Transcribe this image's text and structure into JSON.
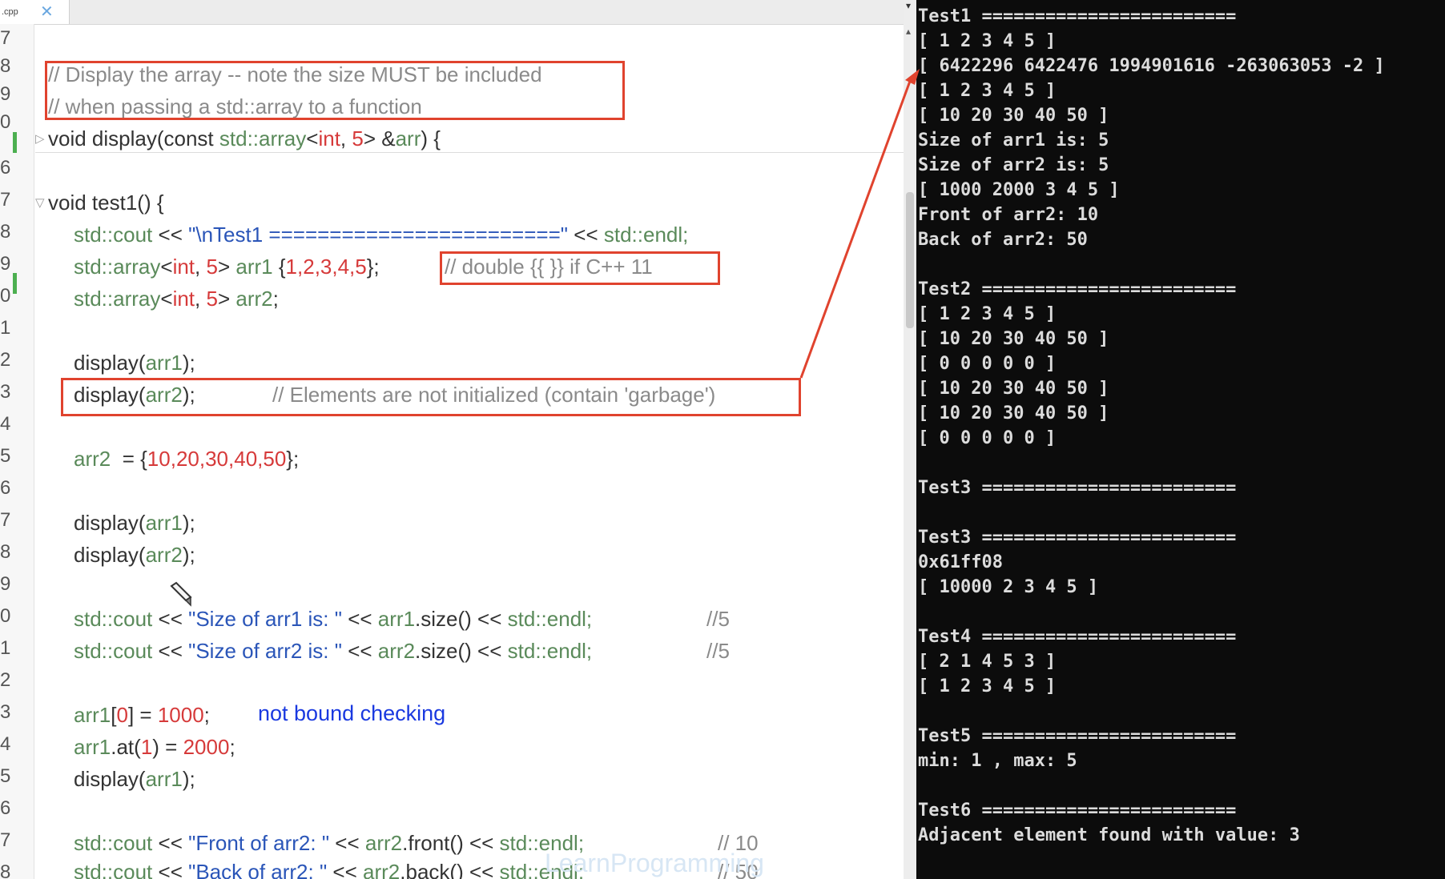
{
  "tab": {
    "filename": ".cpp",
    "close": "✕"
  },
  "line_numbers": [
    "7",
    "8",
    "9",
    "0",
    "6",
    "7",
    "8",
    "9",
    "0",
    "1",
    "2",
    "3",
    "4",
    "5",
    "6",
    "7",
    "8",
    "9",
    "0",
    "1",
    "2",
    "3",
    "4",
    "5",
    "6",
    "7",
    "8"
  ],
  "code": {
    "comment1": "// Display the array -- note the size MUST be included",
    "comment2": "// when passing a std::array to a function",
    "display_sig": [
      "void display(const ",
      "std::array",
      "<",
      "int",
      ", ",
      "5",
      "> &",
      "arr",
      ") {"
    ],
    "test1_sig": "void test1() {",
    "cout_test1": [
      "std::cout",
      " << ",
      "\"\\nTest1 ========================\"",
      " << ",
      "std::endl;"
    ],
    "arr1_decl": [
      "std::array",
      "<",
      "int",
      ", ",
      "5",
      "> ",
      "arr1",
      " {",
      "1,2,3,4,5",
      "};"
    ],
    "arr1_comment": "// double {{ }} if C++ 11",
    "arr2_decl": [
      "std::array",
      "<",
      "int",
      ", ",
      "5",
      "> ",
      "arr2",
      ";"
    ],
    "display_arr1": [
      "display(",
      "arr1",
      ");"
    ],
    "display_arr2": [
      "display(",
      "arr2",
      ");"
    ],
    "display_arr2_comment": "// Elements are not initialized (contain 'garbage')",
    "arr2_assign": [
      "arr2",
      "  = {",
      "10,20,30,40,50",
      "};"
    ],
    "size_arr1": [
      "std::cout",
      " << ",
      "\"Size of arr1 is: \"",
      " << ",
      "arr1",
      ".size() << ",
      "std::endl;",
      "//5"
    ],
    "size_arr2": [
      "std::cout",
      " << ",
      "\"Size of arr2 is: \"",
      " << ",
      "arr2",
      ".size() << ",
      "std::endl;",
      "//5"
    ],
    "arr1_index": [
      "arr1",
      "[",
      "0",
      "] = ",
      "1000",
      ";"
    ],
    "bound_note": "not bound checking",
    "arr1_at": [
      "arr1",
      ".at(",
      "1",
      ") = ",
      "2000",
      ";"
    ],
    "front_line": [
      "std::cout",
      " << ",
      "\"Front of arr2: \"",
      " << ",
      "arr2",
      ".front() << ",
      "std::endl;",
      "// 10"
    ],
    "back_line": [
      "std::cout",
      " << ",
      "\"Back of arr2: \"",
      " << ",
      "arr2",
      ".back() << ",
      "std::endl;",
      "// 50"
    ]
  },
  "watermark": "LearnProgramming",
  "console_lines": [
    "Test1 ========================",
    "[ 1 2 3 4 5 ]",
    "[ 6422296 6422476 1994901616 -263063053 -2 ]",
    "[ 1 2 3 4 5 ]",
    "[ 10 20 30 40 50 ]",
    "Size of arr1 is: 5",
    "Size of arr2 is: 5",
    "[ 1000 2000 3 4 5 ]",
    "Front of arr2: 10",
    "Back of arr2: 50",
    "",
    "Test2 ========================",
    "[ 1 2 3 4 5 ]",
    "[ 10 20 30 40 50 ]",
    "[ 0 0 0 0 0 ]",
    "[ 10 20 30 40 50 ]",
    "[ 10 20 30 40 50 ]",
    "[ 0 0 0 0 0 ]",
    "",
    "Test3 ========================",
    "",
    "Test3 ========================",
    "0x61ff08",
    "[ 10000 2 3 4 5 ]",
    "",
    "Test4 ========================",
    "[ 2 1 4 5 3 ]",
    "[ 1 2 3 4 5 ]",
    "",
    "Test5 ========================",
    "min: 1 , max: 5",
    "",
    "Test6 ========================",
    "Adjacent element found with value: 3"
  ],
  "colors": {
    "annotation": "#e0432e",
    "note": "#1a39e0",
    "console_bg": "#0c0c0c"
  }
}
